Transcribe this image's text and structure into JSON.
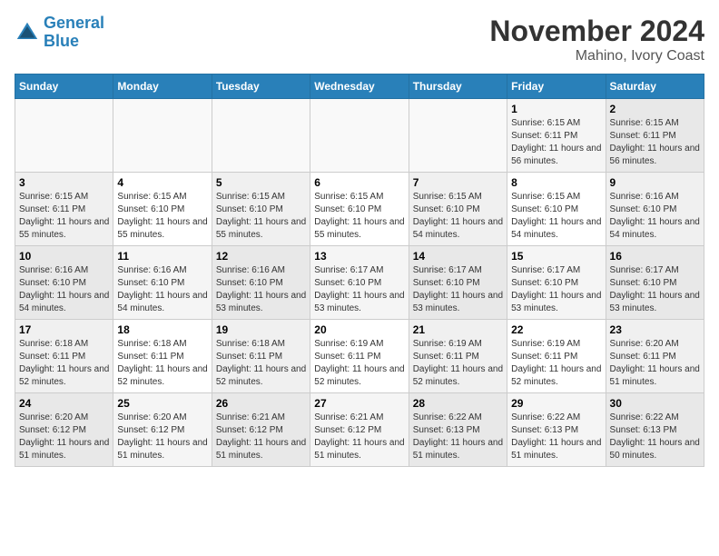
{
  "logo": {
    "line1": "General",
    "line2": "Blue"
  },
  "title": "November 2024",
  "subtitle": "Mahino, Ivory Coast",
  "days_of_week": [
    "Sunday",
    "Monday",
    "Tuesday",
    "Wednesday",
    "Thursday",
    "Friday",
    "Saturday"
  ],
  "weeks": [
    [
      {
        "day": "",
        "info": ""
      },
      {
        "day": "",
        "info": ""
      },
      {
        "day": "",
        "info": ""
      },
      {
        "day": "",
        "info": ""
      },
      {
        "day": "",
        "info": ""
      },
      {
        "day": "1",
        "info": "Sunrise: 6:15 AM\nSunset: 6:11 PM\nDaylight: 11 hours and 56 minutes."
      },
      {
        "day": "2",
        "info": "Sunrise: 6:15 AM\nSunset: 6:11 PM\nDaylight: 11 hours and 56 minutes."
      }
    ],
    [
      {
        "day": "3",
        "info": "Sunrise: 6:15 AM\nSunset: 6:11 PM\nDaylight: 11 hours and 55 minutes."
      },
      {
        "day": "4",
        "info": "Sunrise: 6:15 AM\nSunset: 6:10 PM\nDaylight: 11 hours and 55 minutes."
      },
      {
        "day": "5",
        "info": "Sunrise: 6:15 AM\nSunset: 6:10 PM\nDaylight: 11 hours and 55 minutes."
      },
      {
        "day": "6",
        "info": "Sunrise: 6:15 AM\nSunset: 6:10 PM\nDaylight: 11 hours and 55 minutes."
      },
      {
        "day": "7",
        "info": "Sunrise: 6:15 AM\nSunset: 6:10 PM\nDaylight: 11 hours and 54 minutes."
      },
      {
        "day": "8",
        "info": "Sunrise: 6:15 AM\nSunset: 6:10 PM\nDaylight: 11 hours and 54 minutes."
      },
      {
        "day": "9",
        "info": "Sunrise: 6:16 AM\nSunset: 6:10 PM\nDaylight: 11 hours and 54 minutes."
      }
    ],
    [
      {
        "day": "10",
        "info": "Sunrise: 6:16 AM\nSunset: 6:10 PM\nDaylight: 11 hours and 54 minutes."
      },
      {
        "day": "11",
        "info": "Sunrise: 6:16 AM\nSunset: 6:10 PM\nDaylight: 11 hours and 54 minutes."
      },
      {
        "day": "12",
        "info": "Sunrise: 6:16 AM\nSunset: 6:10 PM\nDaylight: 11 hours and 53 minutes."
      },
      {
        "day": "13",
        "info": "Sunrise: 6:17 AM\nSunset: 6:10 PM\nDaylight: 11 hours and 53 minutes."
      },
      {
        "day": "14",
        "info": "Sunrise: 6:17 AM\nSunset: 6:10 PM\nDaylight: 11 hours and 53 minutes."
      },
      {
        "day": "15",
        "info": "Sunrise: 6:17 AM\nSunset: 6:10 PM\nDaylight: 11 hours and 53 minutes."
      },
      {
        "day": "16",
        "info": "Sunrise: 6:17 AM\nSunset: 6:10 PM\nDaylight: 11 hours and 53 minutes."
      }
    ],
    [
      {
        "day": "17",
        "info": "Sunrise: 6:18 AM\nSunset: 6:11 PM\nDaylight: 11 hours and 52 minutes."
      },
      {
        "day": "18",
        "info": "Sunrise: 6:18 AM\nSunset: 6:11 PM\nDaylight: 11 hours and 52 minutes."
      },
      {
        "day": "19",
        "info": "Sunrise: 6:18 AM\nSunset: 6:11 PM\nDaylight: 11 hours and 52 minutes."
      },
      {
        "day": "20",
        "info": "Sunrise: 6:19 AM\nSunset: 6:11 PM\nDaylight: 11 hours and 52 minutes."
      },
      {
        "day": "21",
        "info": "Sunrise: 6:19 AM\nSunset: 6:11 PM\nDaylight: 11 hours and 52 minutes."
      },
      {
        "day": "22",
        "info": "Sunrise: 6:19 AM\nSunset: 6:11 PM\nDaylight: 11 hours and 52 minutes."
      },
      {
        "day": "23",
        "info": "Sunrise: 6:20 AM\nSunset: 6:11 PM\nDaylight: 11 hours and 51 minutes."
      }
    ],
    [
      {
        "day": "24",
        "info": "Sunrise: 6:20 AM\nSunset: 6:12 PM\nDaylight: 11 hours and 51 minutes."
      },
      {
        "day": "25",
        "info": "Sunrise: 6:20 AM\nSunset: 6:12 PM\nDaylight: 11 hours and 51 minutes."
      },
      {
        "day": "26",
        "info": "Sunrise: 6:21 AM\nSunset: 6:12 PM\nDaylight: 11 hours and 51 minutes."
      },
      {
        "day": "27",
        "info": "Sunrise: 6:21 AM\nSunset: 6:12 PM\nDaylight: 11 hours and 51 minutes."
      },
      {
        "day": "28",
        "info": "Sunrise: 6:22 AM\nSunset: 6:13 PM\nDaylight: 11 hours and 51 minutes."
      },
      {
        "day": "29",
        "info": "Sunrise: 6:22 AM\nSunset: 6:13 PM\nDaylight: 11 hours and 51 minutes."
      },
      {
        "day": "30",
        "info": "Sunrise: 6:22 AM\nSunset: 6:13 PM\nDaylight: 11 hours and 50 minutes."
      }
    ]
  ]
}
